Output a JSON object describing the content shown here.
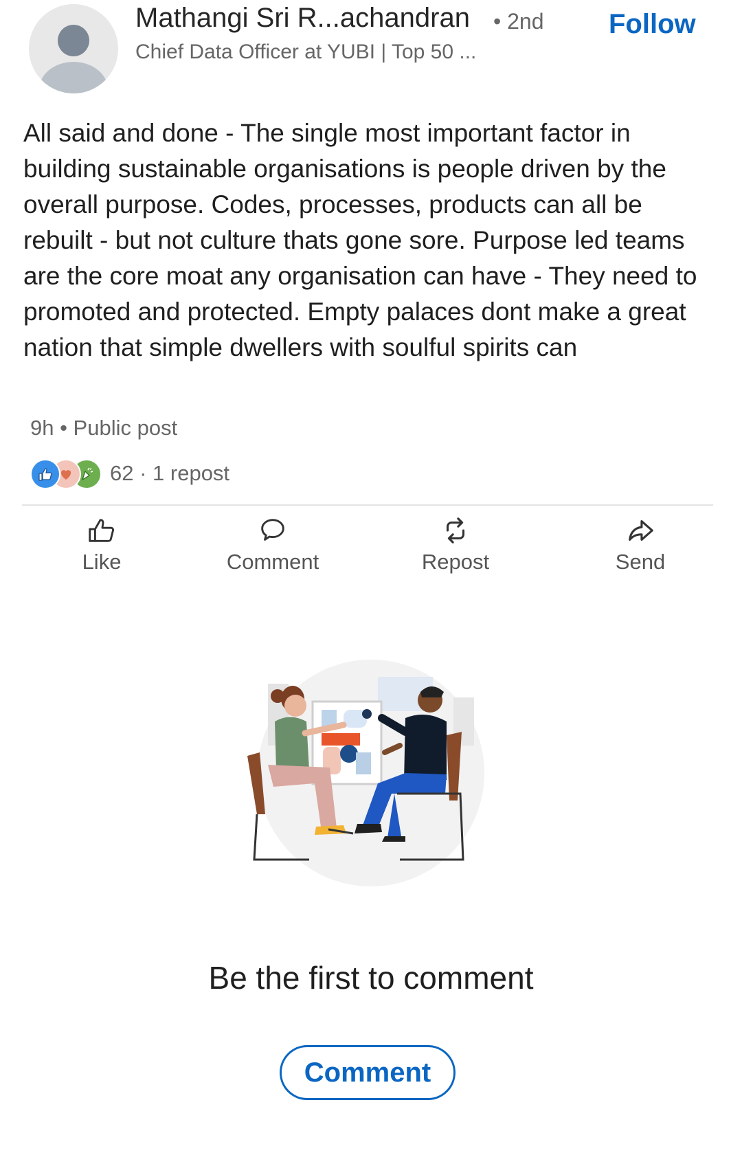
{
  "author": {
    "name": "Mathangi Sri R...achandran",
    "degree": "• 2nd",
    "headline": "Chief Data Officer at YUBI | Top 50 ...",
    "follow_label": "Follow"
  },
  "post": {
    "text": "All said and done - The single most important factor in building sustainable organisations is people driven by the overall purpose. Codes, processes, products can all be rebuilt - but not culture thats gone sore. Purpose led teams are the core moat any organisation can have - They need to promoted and protected. Empty palaces dont make a great nation that simple dwellers with soulful spirits can",
    "meta": "9h • Public post"
  },
  "social": {
    "reaction_icons": [
      "like-icon",
      "love-icon",
      "celebrate-icon"
    ],
    "counts": "62 · 1 repost"
  },
  "actions": {
    "like": "Like",
    "comment": "Comment",
    "repost": "Repost",
    "send": "Send"
  },
  "empty_state": {
    "message": "Be the first to comment",
    "button_label": "Comment"
  },
  "colors": {
    "accent": "#0a66c2",
    "text_primary": "#1f1f1f",
    "text_secondary": "#666666",
    "divider": "#e4e4e4"
  }
}
